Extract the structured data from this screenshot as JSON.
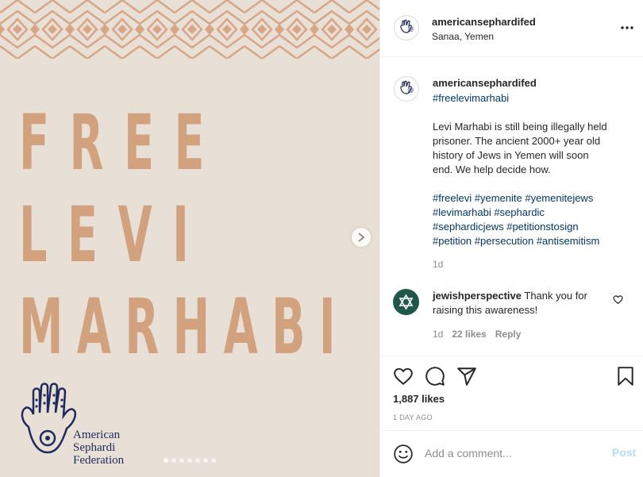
{
  "post": {
    "image_words": [
      "FREE",
      "LEVI",
      "MARHABI"
    ],
    "image_org_lines": [
      "American",
      "Sephardi",
      "Federation"
    ],
    "carousel": {
      "total_slides": 7,
      "current_slide": 1
    },
    "colors": {
      "background": "#e8dfd6",
      "headline": "#d2a17d",
      "logo": "#1f2a5c"
    }
  },
  "header": {
    "username": "americansephardifed",
    "location": "Sanaa, Yemen",
    "more_icon": "more-horizontal-icon"
  },
  "caption": {
    "username": "americansephardifed",
    "first_tag": "#freelevimarhabi",
    "body_lines": [
      "Levi Marhabi is still being illegally held",
      "prisoner. The ancient 2000+ year old",
      "history of Jews in Yemen will soon",
      "end. We help decide how."
    ],
    "hashtag_lines": [
      "#freelevi #yemenite #yemenitejews",
      "#levimarhabi #sephardic",
      "#sephardicjews #petitionstosign",
      "#petition #persecution #antisemitism"
    ],
    "time": "1d"
  },
  "comment": {
    "username": "jewishperspective",
    "text": " Thank you for raising this awareness!",
    "time": "1d",
    "likes": "22 likes",
    "reply_label": "Reply"
  },
  "actions": {
    "likes": "1,887 likes",
    "posted": "1 DAY AGO"
  },
  "add_comment": {
    "placeholder": "Add a comment...",
    "post_label": "Post"
  }
}
